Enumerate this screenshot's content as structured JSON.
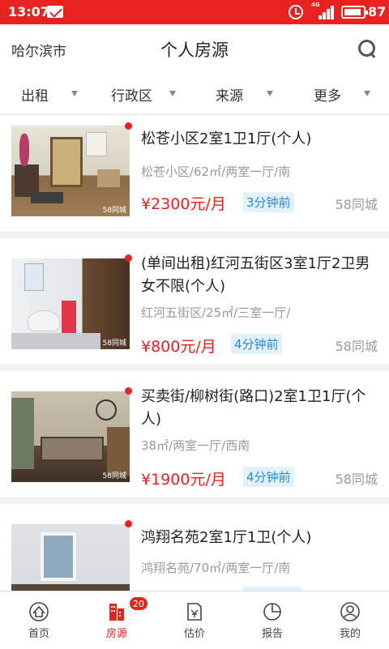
{
  "status_bar": {
    "time": "13:07",
    "network": "4G",
    "battery": "87"
  },
  "header": {
    "city": "哈尔滨市",
    "title": "个人房源"
  },
  "filters": [
    {
      "label": "出租"
    },
    {
      "label": "行政区"
    },
    {
      "label": "来源"
    },
    {
      "label": "更多"
    }
  ],
  "listings": [
    {
      "title": "松苍小区2室1卫1厅(个人)",
      "meta": "松苍小区/62㎡/两室一厅/南",
      "price": "¥2300元/月",
      "time": "3分钟前",
      "source": "58同城",
      "watermark": "58同城"
    },
    {
      "title": "(单间出租)红河五街区3室1厅2卫男女不限(个人)",
      "meta": "红河五街区/25㎡/三室一厅/",
      "price": "¥800元/月",
      "time": "4分钟前",
      "source": "58同城",
      "watermark": "58同城"
    },
    {
      "title": "买卖街/柳树街(路口)2室1卫1厅(个人)",
      "meta": "38㎡/两室一厅/西南",
      "price": "¥1900元/月",
      "time": "4分钟前",
      "source": "58同城",
      "watermark": "58同城"
    },
    {
      "title": "鸿翔名苑2室1厅1卫(个人)",
      "meta": "鸿翔名苑/70㎡/两室一厅/南",
      "price": "",
      "time": "",
      "source": "",
      "watermark": ""
    }
  ],
  "tabbar": {
    "items": [
      {
        "label": "首页",
        "icon": "home-icon"
      },
      {
        "label": "房源",
        "icon": "building-icon",
        "badge": "20",
        "active": true
      },
      {
        "label": "估价",
        "icon": "valuation-icon"
      },
      {
        "label": "报告",
        "icon": "pie-chart-icon"
      },
      {
        "label": "我的",
        "icon": "profile-icon"
      }
    ]
  },
  "colors": {
    "brand": "#e8231f",
    "time_tag_text": "#2b88d8",
    "time_tag_bg": "#e3f1fb",
    "meta": "#9a9a9a"
  }
}
